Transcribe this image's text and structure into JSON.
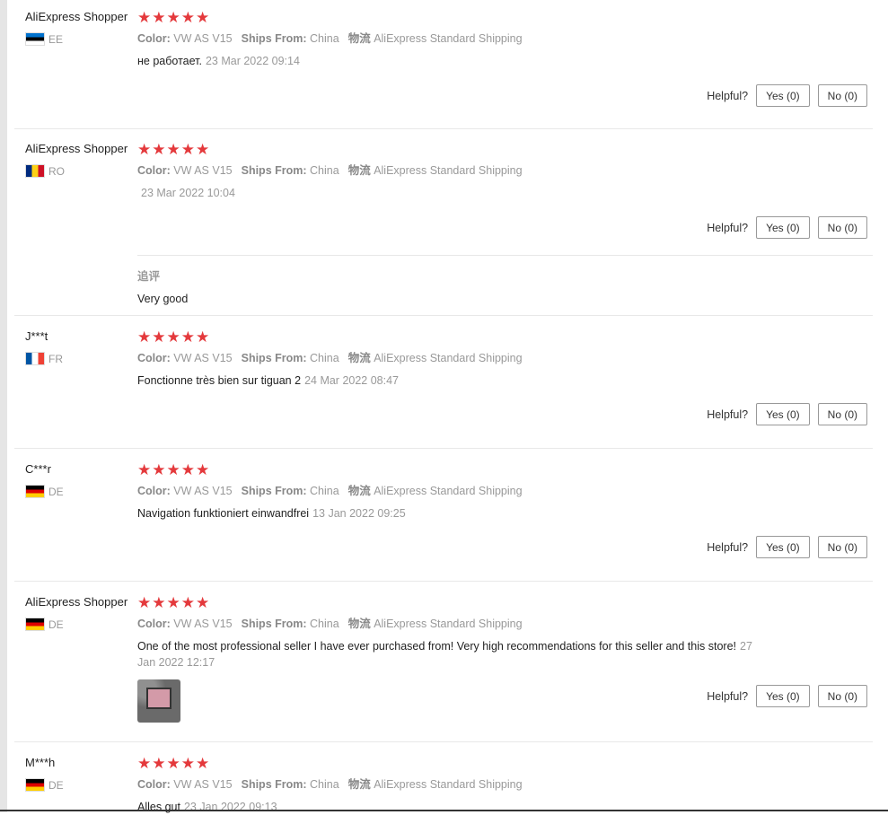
{
  "reviews": [
    {
      "buyer": "AliExpress Shopper",
      "country": "EE",
      "color_label": "Color:",
      "color_value": "VW AS V15",
      "ships_label": "Ships From:",
      "ships_value": "China",
      "logistics_label": "物流",
      "logistics_value": "AliExpress Standard Shipping",
      "text": "не работает.",
      "date": "23 Mar 2022 09:14",
      "helpful_label": "Helpful?",
      "yes_label": "Yes (0)",
      "no_label": "No (0)"
    },
    {
      "buyer": "AliExpress Shopper",
      "country": "RO",
      "color_label": "Color:",
      "color_value": "VW AS V15",
      "ships_label": "Ships From:",
      "ships_value": "China",
      "logistics_label": "物流",
      "logistics_value": "AliExpress Standard Shipping",
      "text": "",
      "date": "23 Mar 2022 10:04",
      "helpful_label": "Helpful?",
      "yes_label": "Yes (0)",
      "no_label": "No (0)",
      "append_title": "追评",
      "append_text": "Very good"
    },
    {
      "buyer": "J***t",
      "country": "FR",
      "color_label": "Color:",
      "color_value": "VW AS V15",
      "ships_label": "Ships From:",
      "ships_value": "China",
      "logistics_label": "物流",
      "logistics_value": "AliExpress Standard Shipping",
      "text": "Fonctionne très bien sur tiguan 2",
      "date": "24 Mar 2022 08:47",
      "helpful_label": "Helpful?",
      "yes_label": "Yes (0)",
      "no_label": "No (0)"
    },
    {
      "buyer": "C***r",
      "country": "DE",
      "color_label": "Color:",
      "color_value": "VW AS V15",
      "ships_label": "Ships From:",
      "ships_value": "China",
      "logistics_label": "物流",
      "logistics_value": "AliExpress Standard Shipping",
      "text": "Navigation funktioniert einwandfrei",
      "date": "13 Jan 2022 09:25",
      "helpful_label": "Helpful?",
      "yes_label": "Yes (0)",
      "no_label": "No (0)"
    },
    {
      "buyer": "AliExpress Shopper",
      "country": "DE",
      "color_label": "Color:",
      "color_value": "VW AS V15",
      "ships_label": "Ships From:",
      "ships_value": "China",
      "logistics_label": "物流",
      "logistics_value": "AliExpress Standard Shipping",
      "text": "One of the most professional seller I have ever purchased from! Very high recommendations for this seller and this store!",
      "date": "27 Jan 2022 12:17",
      "helpful_label": "Helpful?",
      "yes_label": "Yes (0)",
      "no_label": "No (0)"
    },
    {
      "buyer": "M***h",
      "country": "DE",
      "color_label": "Color:",
      "color_value": "VW AS V15",
      "ships_label": "Ships From:",
      "ships_value": "China",
      "logistics_label": "物流",
      "logistics_value": "AliExpress Standard Shipping",
      "text": "Alles gut",
      "date": "23 Jan 2022 09:13"
    }
  ],
  "rating_stars": 5,
  "colors": {
    "star": "#e4393c",
    "muted": "#999999",
    "divider": "#e8e8e8"
  }
}
